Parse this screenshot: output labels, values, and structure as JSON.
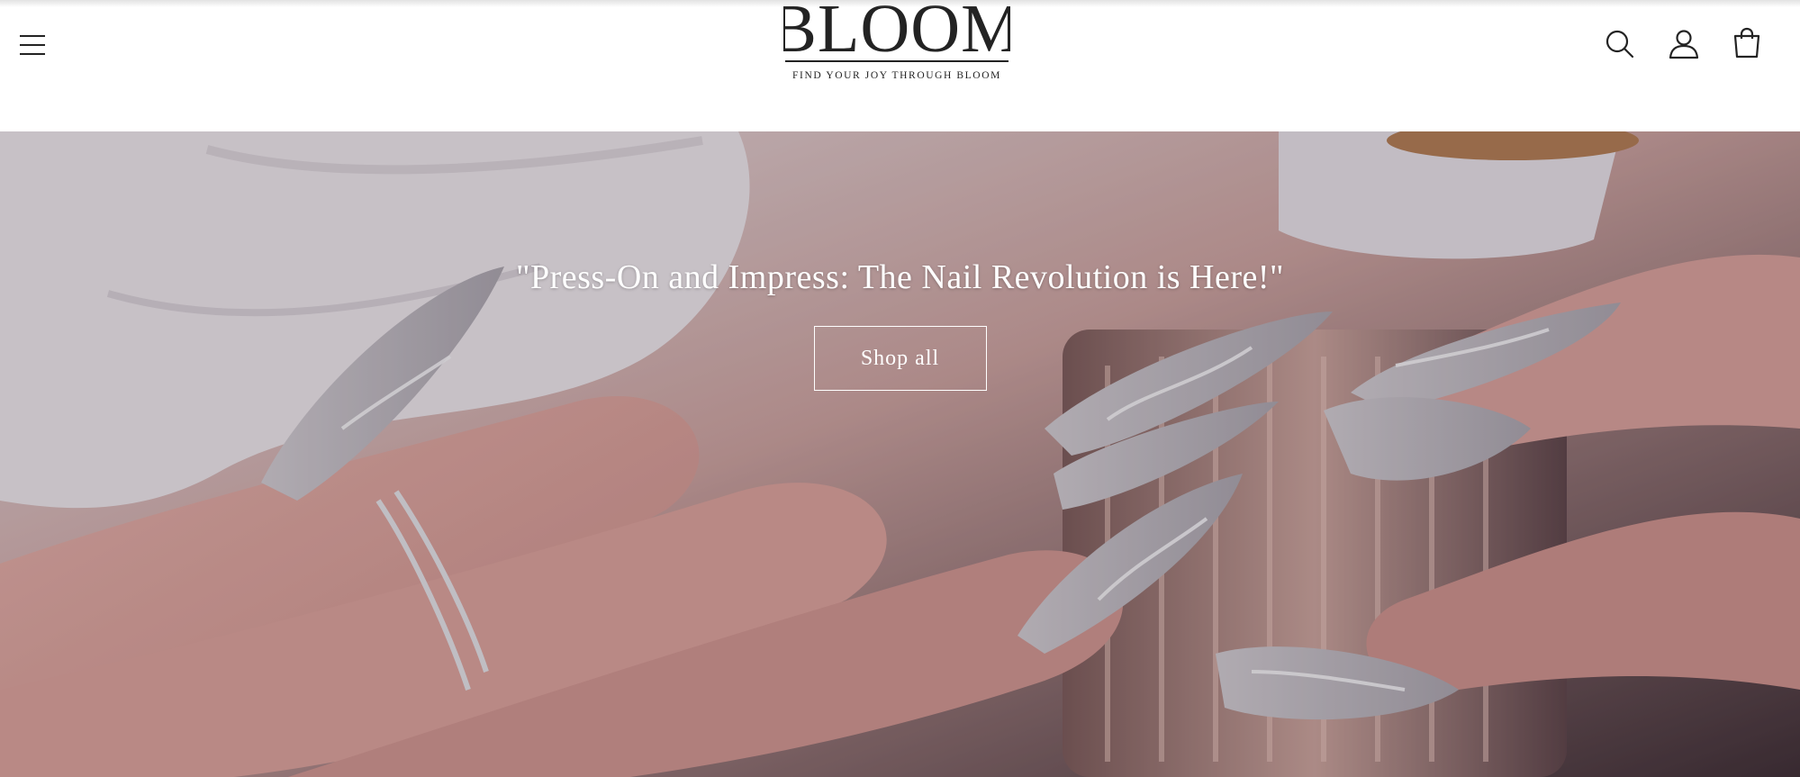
{
  "header": {
    "menu_icon": "hamburger-menu-icon",
    "logo": {
      "wordmark": "BLOOM",
      "tagline": "FIND YOUR JOY THROUGH BLOOM"
    },
    "icons": {
      "search": "search-icon",
      "account": "account-icon",
      "cart": "cart-icon"
    }
  },
  "hero": {
    "heading": "\"Press-On and Impress: The Nail Revolution is Here!\"",
    "button_label": "Shop all",
    "image": "hands-with-press-on-nails-holding-perfume-bottle"
  },
  "colors": {
    "header_bg": "#ffffff",
    "logo_ink": "#232323",
    "hero_text": "#ffffff",
    "skin_tone": "#d79f98",
    "nail_tone": "#b9b6bc"
  }
}
